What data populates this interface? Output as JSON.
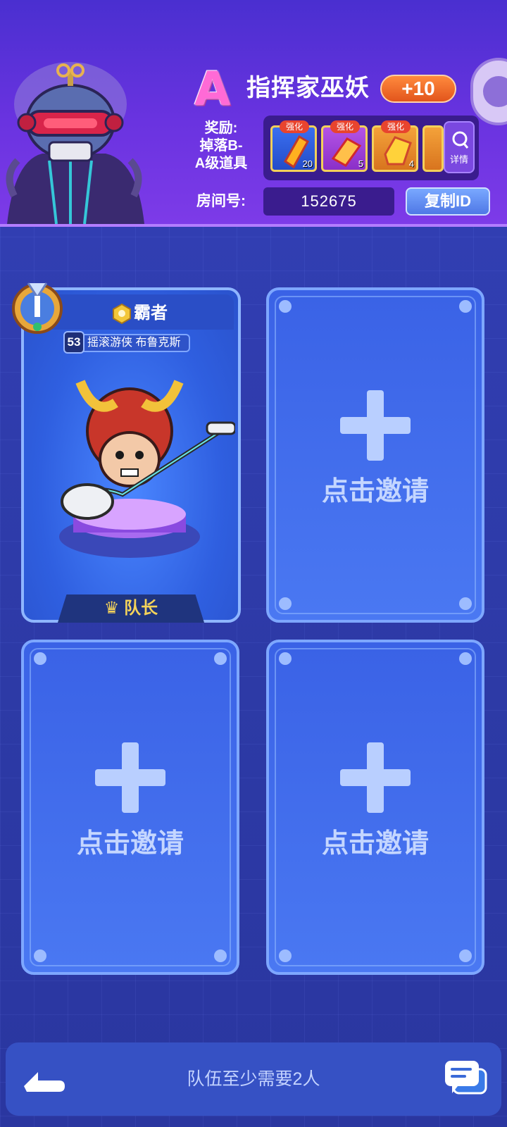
{
  "header": {
    "grade": "A",
    "boss_name": "指挥家巫妖",
    "bonus": "+10",
    "reward_label": "奖励:\n掉落B-\nA级道具",
    "reward_items": [
      {
        "tag": "强化",
        "count": "20",
        "style": "blue"
      },
      {
        "tag": "强化",
        "count": "5",
        "style": "purple"
      },
      {
        "tag": "强化",
        "count": "4",
        "style": "orange"
      }
    ],
    "detail_label": "详情",
    "room_label": "房间号:",
    "room_number": "152675",
    "copy_id_label": "复制ID"
  },
  "leader_slot": {
    "title": "霸者",
    "level": "53",
    "player_name": "摇滚游侠 布鲁克斯",
    "role": "队长"
  },
  "empty_slots": [
    {
      "invite": "点击邀请"
    },
    {
      "invite": "点击邀请"
    },
    {
      "invite": "点击邀请"
    }
  ],
  "footer": {
    "hint": "队伍至少需要2人"
  },
  "colors": {
    "header_bg": "#6a33e0",
    "page_bg": "#2f3fae",
    "slot_bg": "#3a62e6",
    "bonus_orange": "#e2551c",
    "copy_blue": "#4f78e6",
    "grade_pink": "#ff6ad6"
  },
  "icons": [
    "lich-boss-portrait",
    "gem-item-icon",
    "search-icon",
    "rank-medal-icon",
    "crown-icon",
    "back-arrow-icon",
    "chat-icon",
    "avatar-bubble-icon",
    "plus-icon"
  ]
}
